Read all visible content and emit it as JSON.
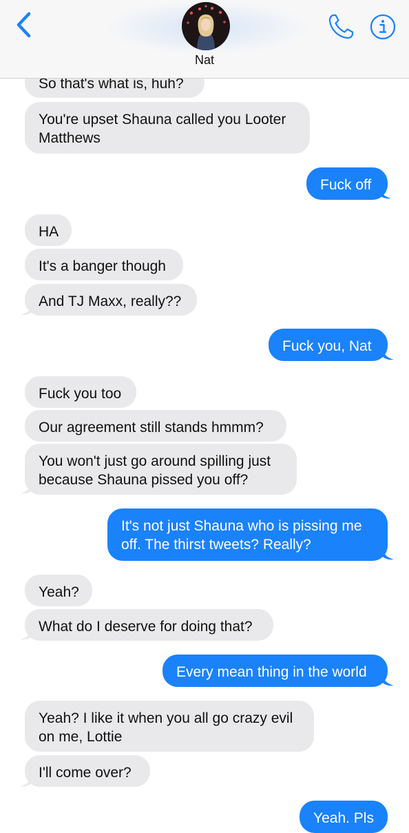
{
  "header": {
    "contact_name": "Nat",
    "back_icon": "chevron-left-icon",
    "call_icon": "phone-icon",
    "info_icon": "info-icon",
    "accent_color": "#1a82fb"
  },
  "messages": [
    {
      "from": "them",
      "text": "So that's what is, huh?"
    },
    {
      "from": "them",
      "lines": [
        "You're upset Shauna called you Looter",
        "Matthews"
      ]
    },
    {
      "from": "me",
      "text": "Fuck off"
    },
    {
      "from": "them",
      "text": "HA"
    },
    {
      "from": "them",
      "text": "It's a banger though"
    },
    {
      "from": "them",
      "text": "And TJ Maxx, really??"
    },
    {
      "from": "me",
      "text": "Fuck you, Nat"
    },
    {
      "from": "them",
      "text": "Fuck you too"
    },
    {
      "from": "them",
      "text": "Our agreement still stands hmmm?"
    },
    {
      "from": "them",
      "lines": [
        "You won't just go around spilling just",
        "because Shauna pissed you off?"
      ]
    },
    {
      "from": "me",
      "lines": [
        "It's not just Shauna who is pissing me",
        "off. The thirst tweets? Really?"
      ]
    },
    {
      "from": "them",
      "text": "Yeah?"
    },
    {
      "from": "them",
      "text": "What do I deserve for doing that?"
    },
    {
      "from": "me",
      "text": "Every mean thing in the world"
    },
    {
      "from": "them",
      "lines": [
        "Yeah? I like it when you all go crazy evil",
        "on me, Lottie"
      ]
    },
    {
      "from": "them",
      "text": "I'll come over?"
    },
    {
      "from": "me",
      "text": "Yeah. Pls"
    }
  ],
  "colors": {
    "incoming_bubble": "#e9e9eb",
    "outgoing_bubble": "#1a82fb",
    "header_background": "#f7f7f8"
  }
}
